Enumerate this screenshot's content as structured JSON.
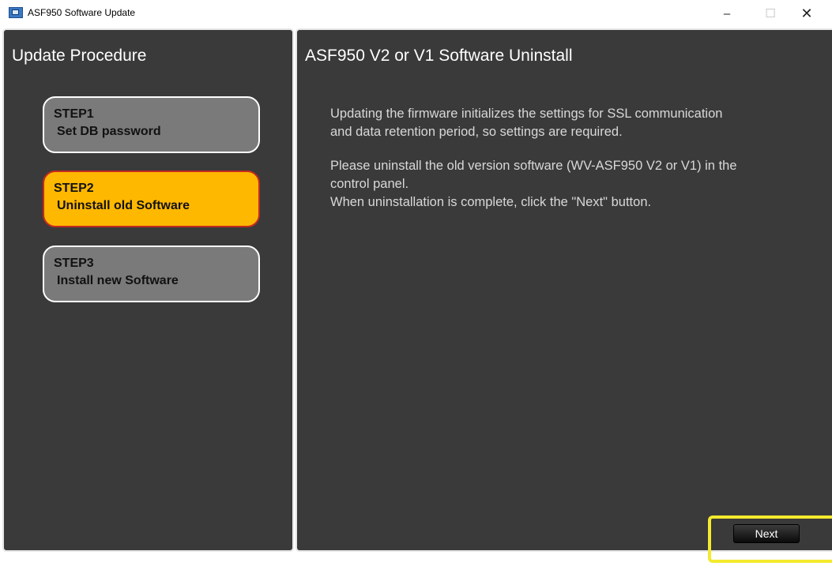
{
  "window": {
    "title": "ASF950 Software Update",
    "controls": {
      "minimize": "–",
      "maximize": "☐",
      "close": "✕"
    }
  },
  "sidebar": {
    "title": "Update Procedure",
    "steps": [
      {
        "line1": "STEP1",
        "line2": "Set DB password",
        "state": "inactive"
      },
      {
        "line1": "STEP2",
        "line2": "Uninstall old Software",
        "state": "active"
      },
      {
        "line1": "STEP3",
        "line2": "Install new Software",
        "state": "inactive"
      }
    ]
  },
  "main": {
    "title": "ASF950 V2 or V1 Software Uninstall",
    "paragraph1": [
      "Updating the firmware initializes the settings for SSL communication",
      "and data retention period, so settings are required."
    ],
    "paragraph2": [
      "Please uninstall the old version software (WV-ASF950 V2 or V1) in the",
      "control panel.",
      "When uninstallation is complete, click the \"Next\" button."
    ]
  },
  "footer": {
    "next_label": "Next"
  },
  "colors": {
    "panel_bg": "#3a3a3a",
    "active_step": "#ffb800",
    "active_step_border": "#c52a1e",
    "inactive_step": "#7a7a7a",
    "highlight": "#f3ea2d"
  }
}
